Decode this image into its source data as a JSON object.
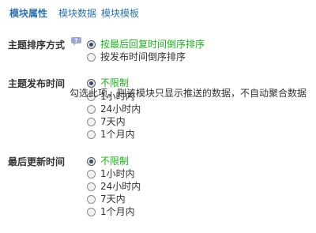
{
  "tabs": [
    {
      "label": "模块属性",
      "active": true
    },
    {
      "label": "模块数据",
      "active": false
    },
    {
      "label": "模块模板",
      "active": false
    }
  ],
  "sections": [
    {
      "label": "主题排序方式",
      "has_help_icon": true,
      "options": [
        {
          "label": "按最后回复时间倒序排序",
          "selected": true
        },
        {
          "label": "按发布时间倒序排序",
          "selected": false
        }
      ]
    },
    {
      "label": "主题发布时间",
      "has_help_icon": false,
      "options": [
        {
          "label": "不限制",
          "selected": true
        },
        {
          "label": "1小时内",
          "selected": false
        },
        {
          "label": "24小时内",
          "selected": false
        },
        {
          "label": "7天内",
          "selected": false
        },
        {
          "label": "1个月内",
          "selected": false
        }
      ]
    },
    {
      "label": "最后更新时间",
      "has_help_icon": false,
      "options": [
        {
          "label": "不限制",
          "selected": true
        },
        {
          "label": "1小时内",
          "selected": false
        },
        {
          "label": "24小时内",
          "selected": false
        },
        {
          "label": "7天内",
          "selected": false
        },
        {
          "label": "1个月内",
          "selected": false
        }
      ]
    }
  ],
  "tooltip": {
    "text": "勾选此项，则该模块只显示推送的数据，不自动聚合数据"
  },
  "colors": {
    "tab_link": "#2b73b5",
    "selected_text": "#19b51a",
    "help_icon": "#9aa6d6"
  },
  "icons": {
    "help": "question-bubble-icon",
    "radio": "radio-icon"
  }
}
